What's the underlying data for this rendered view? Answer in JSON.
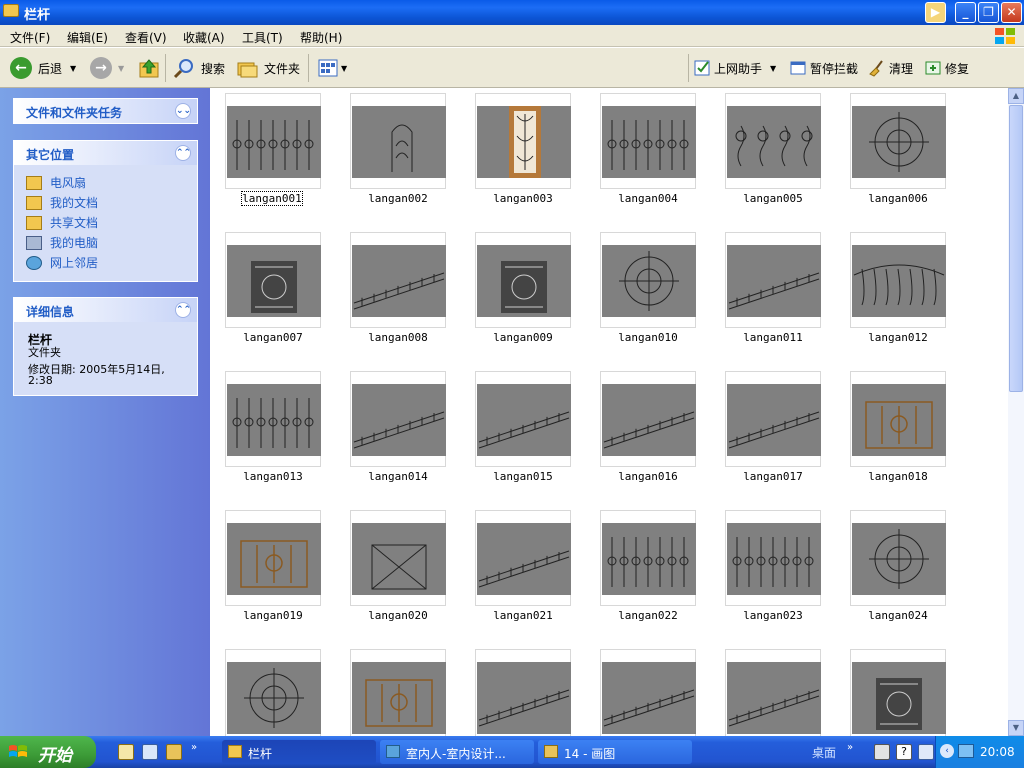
{
  "window": {
    "title": "栏杆"
  },
  "menu": [
    "文件(F)",
    "编辑(E)",
    "查看(V)",
    "收藏(A)",
    "工具(T)",
    "帮助(H)"
  ],
  "toolbar": {
    "back": "后退",
    "search": "搜索",
    "folders": "文件夹",
    "plugin1": "上网助手",
    "plugin2": "暂停拦截",
    "plugin3": "清理",
    "plugin4": "修复"
  },
  "sidebar": {
    "tasks_title": "文件和文件夹任务",
    "places_title": "其它位置",
    "places": [
      "电风扇",
      "我的文档",
      "共享文档",
      "我的电脑",
      "网上邻居"
    ],
    "details_title": "详细信息",
    "details_name": "栏杆",
    "details_type": "文件夹",
    "details_date_line1": "修改日期: 2005年5月14日,",
    "details_date_line2": "2:38"
  },
  "files": [
    "langan001",
    "langan002",
    "langan003",
    "langan004",
    "langan005",
    "langan006",
    "langan007",
    "langan008",
    "langan009",
    "langan010",
    "langan011",
    "langan012",
    "langan013",
    "langan014",
    "langan015",
    "langan016",
    "langan017",
    "langan018",
    "langan019",
    "langan020",
    "langan021",
    "langan022",
    "langan023",
    "langan024",
    "",
    "",
    "",
    "",
    "",
    ""
  ],
  "selected_file": "langan001",
  "taskbar": {
    "start": "开始",
    "tasks": [
      "栏杆",
      "室内人-室内设计...",
      "14 - 画图"
    ],
    "desktop": "桌面",
    "clock": "20:08"
  },
  "colors": {
    "title_blue": "#0a5be8",
    "sidebar_blue": "#7ba2e7",
    "start_green": "#3c9b37",
    "thumb_gray": "#808080"
  }
}
